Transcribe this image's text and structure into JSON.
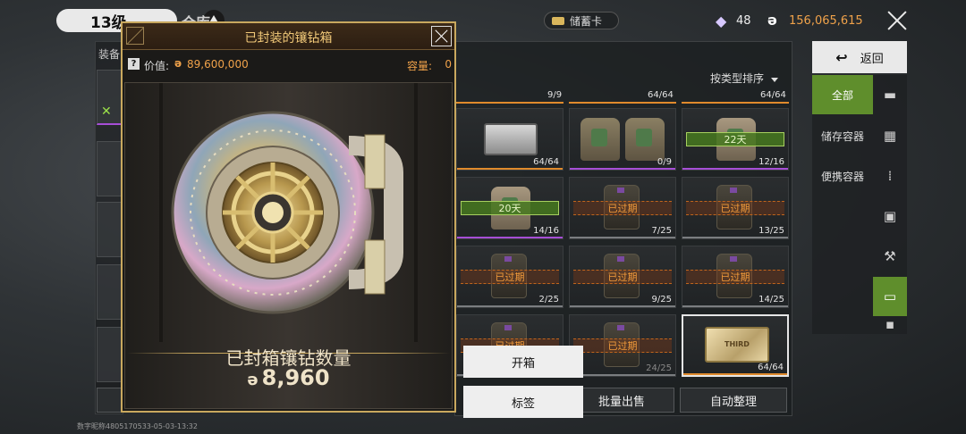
{
  "top_bar": {
    "level": "13级",
    "title": "仓库",
    "savings_card": "储蓄卡",
    "diamond_count": "48",
    "coin_balance": "156,065,615",
    "coin_symbol": "ə"
  },
  "left_panel": {
    "label": "装备"
  },
  "sort": {
    "label": "按类型排序"
  },
  "grid": {
    "top_row_counts": [
      "9/9",
      "64/64",
      "64/64"
    ],
    "cells": [
      {
        "type": "case",
        "count": "64/64"
      },
      {
        "type": "bags",
        "count": "0/9"
      },
      {
        "type": "vest",
        "tag": "22天",
        "count": "12/16"
      },
      {
        "type": "vest",
        "tag": "20天",
        "count": "14/16"
      },
      {
        "type": "vest",
        "tag": "已过期",
        "count": "7/25"
      },
      {
        "type": "vest",
        "tag": "已过期",
        "count": "13/25"
      },
      {
        "type": "vest",
        "tag": "已过期",
        "count": "2/25"
      },
      {
        "type": "vest",
        "tag": "已过期",
        "count": "9/25"
      },
      {
        "type": "vest",
        "tag": "已过期",
        "count": "14/25"
      },
      {
        "type": "vest",
        "tag": "已过期",
        "count": ""
      },
      {
        "type": "vest",
        "tag": "已过期",
        "count": "24/25"
      },
      {
        "type": "gold-case",
        "tag": "",
        "count": "64/64",
        "brand": "THIRD"
      }
    ]
  },
  "sidebar": {
    "back_label": "返回",
    "categories": [
      "全部",
      "储存容器",
      "便携容器"
    ],
    "icons": [
      "pistol-icon",
      "vest-icon",
      "ammo-icon",
      "medkit-icon",
      "hammer-icon",
      "case-icon",
      "more-icon"
    ]
  },
  "buttons": {
    "open_box": "开箱",
    "label": "标签",
    "bulk_sell": "批量出售",
    "auto_sort": "自动整理"
  },
  "popup": {
    "title": "已封装的镶钻箱",
    "value_label": "价值:",
    "value_amount": "89,600,000",
    "capacity_label": "容量:",
    "capacity_value": "0",
    "count_label": "已封箱镶钻数量",
    "count_value": "8,960"
  },
  "footer": {
    "player_id": "数字昵称4805170533-05-03-13:32"
  },
  "colors": {
    "gold_border": "#c9a85e",
    "accent_green": "#5f8e2c",
    "coin_orange": "#f0a24a"
  }
}
